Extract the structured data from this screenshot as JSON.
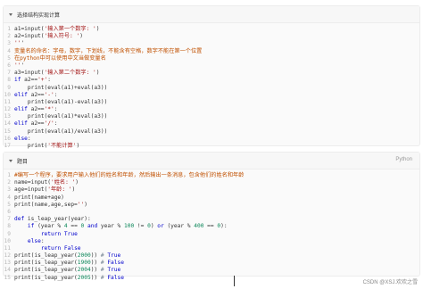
{
  "panel1": {
    "title": "选择结构实现计算",
    "lines": [
      "a1=input('输入第一个数字: ')",
      "a2=input('输入符号: ')",
      "'''",
      "变量名的命名：字母，数字，下划线，不能含有空格，数字不能在第一个位置",
      "在python中可以使用中文当做变量名",
      "'''",
      "a3=input('输入第二个数字: ')",
      "if a2=='+':",
      "    print(eval(a1)+eval(a3))",
      "elif a2=='-':",
      "    print(eval(a1)-eval(a3))",
      "elif a2=='*':",
      "    print(eval(a1)*eval(a3))",
      "elif a2=='/':",
      "    print(eval(a1)/eval(a3))",
      "else:",
      "    print('不能计算')"
    ]
  },
  "panel2": {
    "title": "题目",
    "language": "Python",
    "lines": [
      "#编写一个程序，要求用户输入他们的姓名和年龄，然后输出一条消息，包含他们的姓名和年龄",
      "name=input('姓名: ')",
      "age=input('年龄: ')",
      "print(name+age)",
      "print(name,age,sep='')",
      "",
      "def is_leap_year(year):",
      "    if (year % 4 == 0 and year % 100 != 0) or (year % 400 == 0):",
      "        return True",
      "    else:",
      "        return False",
      "print(is_leap_year(2000)) # True",
      "print(is_leap_year(1900)) # False",
      "print(is_leap_year(2004)) # True",
      "print(is_leap_year(2005)) # False"
    ]
  },
  "footer": {
    "text": "CSDN @XSJ.欢欢之雪"
  }
}
